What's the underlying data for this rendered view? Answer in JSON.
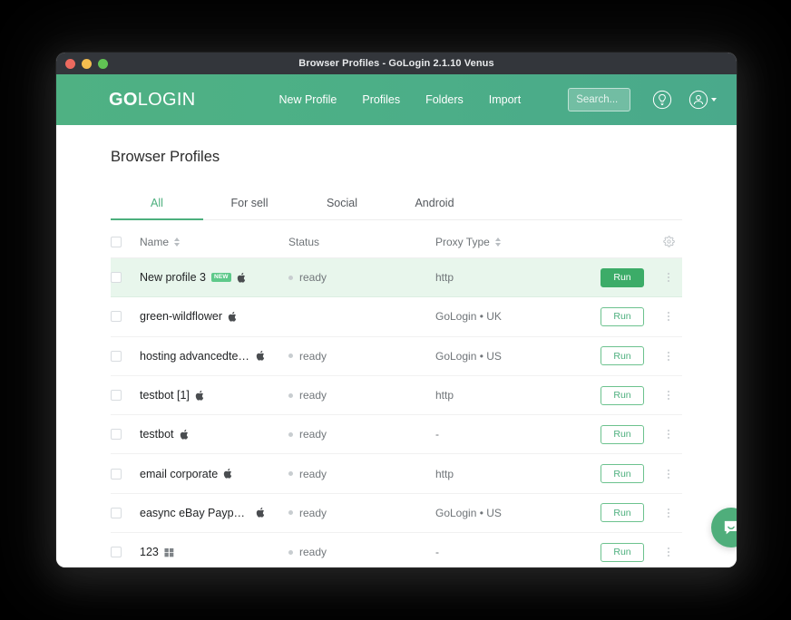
{
  "window": {
    "title": "Browser Profiles - GoLogin 2.1.10 Venus"
  },
  "header": {
    "logo_bold": "GO",
    "logo_light": "LOGIN",
    "nav": [
      {
        "label": "New Profile"
      },
      {
        "label": "Profiles"
      },
      {
        "label": "Folders"
      },
      {
        "label": "Import"
      }
    ],
    "search": {
      "placeholder": "Search...",
      "value": ""
    },
    "bulb_icon": "lightbulb-icon",
    "account_icon": "user-account-icon"
  },
  "main": {
    "page_title": "Browser Profiles",
    "tabs": [
      {
        "label": "All",
        "active": true
      },
      {
        "label": "For sell",
        "active": false
      },
      {
        "label": "Social",
        "active": false
      },
      {
        "label": "Android",
        "active": false
      }
    ],
    "table": {
      "columns": {
        "name": "Name",
        "status": "Status",
        "proxy": "Proxy Type"
      },
      "settings_icon": "gear-icon",
      "rows": [
        {
          "name": "New profile 3",
          "badge": "NEW",
          "os": "apple-icon",
          "status": "ready",
          "proxy": "http",
          "run_label": "Run",
          "selected": true
        },
        {
          "name": "green-wildflower",
          "badge": "",
          "os": "apple-icon",
          "status": "",
          "proxy": "GoLogin • UK",
          "run_label": "Run",
          "selected": false
        },
        {
          "name": "hosting advancedtech-a…",
          "badge": "",
          "os": "apple-icon",
          "status": "ready",
          "proxy": "GoLogin • US",
          "run_label": "Run",
          "selected": false
        },
        {
          "name": "testbot [1]",
          "badge": "",
          "os": "apple-icon",
          "status": "ready",
          "proxy": "http",
          "run_label": "Run",
          "selected": false
        },
        {
          "name": "testbot",
          "badge": "",
          "os": "apple-icon",
          "status": "ready",
          "proxy": "-",
          "run_label": "Run",
          "selected": false
        },
        {
          "name": "email corporate",
          "badge": "",
          "os": "apple-icon",
          "status": "ready",
          "proxy": "http",
          "run_label": "Run",
          "selected": false
        },
        {
          "name": "easync eBay Paypal here",
          "badge": "",
          "os": "apple-icon",
          "status": "ready",
          "proxy": "GoLogin • US",
          "run_label": "Run",
          "selected": false
        },
        {
          "name": "123",
          "badge": "",
          "os": "windows-icon",
          "status": "ready",
          "proxy": "-",
          "run_label": "Run",
          "selected": false
        }
      ]
    }
  },
  "chat": {
    "icon": "chat-bubble-icon"
  },
  "colors": {
    "header_green": "#4caf87",
    "accent_green": "#4caf7d",
    "run_primary": "#3cac68",
    "selected_row": "#e8f6ec",
    "badge_green": "#5ec98a",
    "titlebar": "#33363b"
  }
}
